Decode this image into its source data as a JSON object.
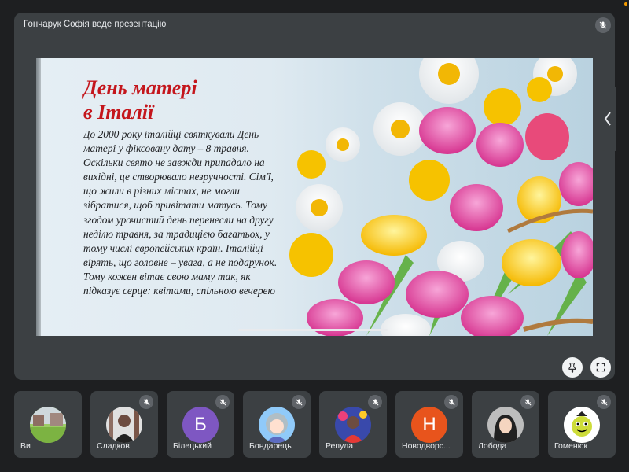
{
  "presenter": {
    "banner": "Гончарук Софія веде презентацію",
    "mic_icon": "mic-off-icon"
  },
  "slide": {
    "title_line1": "День матері",
    "title_line2": "в Італії",
    "body": "До 2000 року італійці святкували День матері у фіксовану дату – 8 травня. Оскільки свято не завжди припадало на вихідні, це створювало незручності. Сім'ї, що жили в різних містах, не могли зібратися, щоб привітати матусь. Тому згодом урочистий день перенесли на другу неділю травня, за традицією багатьох, у тому числі європейських країн. Італійці вірять, що головне – увага, а не подарунок. Тому кожен вітає свою маму так, як підказує серце: квітами, спільною вечерею",
    "title_color": "#c4161c"
  },
  "controls": {
    "pin_icon": "pin-icon",
    "fullscreen_icon": "fullscreen-icon",
    "side_panel_icon": "chevron-left-icon"
  },
  "participants": [
    {
      "name": "Ви",
      "avatar": "photo",
      "initial": "",
      "muted": false
    },
    {
      "name": "Сладков",
      "avatar": "photo",
      "initial": "",
      "muted": true
    },
    {
      "name": "Білецький",
      "avatar": "letter",
      "initial": "Б",
      "color": "#7e57c2",
      "muted": true
    },
    {
      "name": "Бондарець",
      "avatar": "photo",
      "initial": "",
      "muted": true
    },
    {
      "name": "Репула",
      "avatar": "photo",
      "initial": "",
      "muted": true
    },
    {
      "name": "Новодворс...",
      "avatar": "letter",
      "initial": "Н",
      "color": "#e8541c",
      "muted": true
    },
    {
      "name": "Лобода",
      "avatar": "photo",
      "initial": "",
      "muted": true
    },
    {
      "name": "Гоменюк",
      "avatar": "photo",
      "initial": "",
      "muted": true
    }
  ],
  "colors": {
    "background": "#1e1f21",
    "tile": "#3c4043",
    "status_dot": "#f29900"
  }
}
